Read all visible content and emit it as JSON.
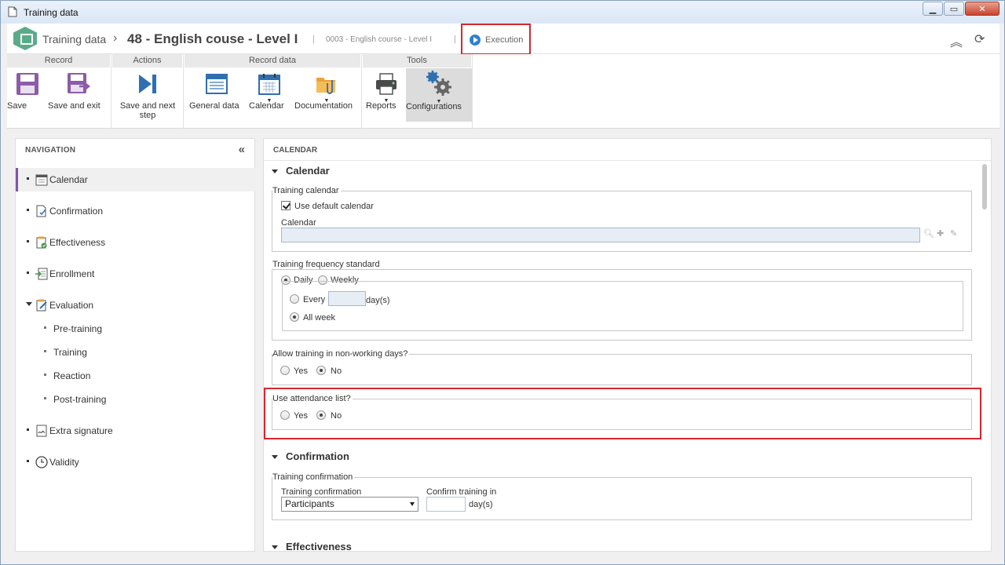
{
  "window": {
    "title": "Training data",
    "controls": [
      "minimize",
      "maximize",
      "close"
    ]
  },
  "header": {
    "app_name": "Training data",
    "separator": "›",
    "record_title": "48 - English couse - Level I",
    "pipe": "|",
    "record_code": "0003 - English course - Level I",
    "status": "Execution"
  },
  "ribbon": {
    "groups": [
      {
        "title": "Record",
        "buttons": [
          {
            "label": "Save"
          },
          {
            "label": "Save and exit"
          }
        ]
      },
      {
        "title": "Actions",
        "buttons": [
          {
            "label": "Save and next step"
          }
        ]
      },
      {
        "title": "Record data",
        "buttons": [
          {
            "label": "General data"
          },
          {
            "label": "Calendar"
          },
          {
            "label": "Documentation"
          }
        ]
      },
      {
        "title": "Tools",
        "buttons": [
          {
            "label": "Reports"
          },
          {
            "label": "Configurations"
          }
        ]
      }
    ]
  },
  "nav": {
    "title": "NAVIGATION",
    "items": [
      {
        "label": "Calendar"
      },
      {
        "label": "Confirmation"
      },
      {
        "label": "Effectiveness"
      },
      {
        "label": "Enrollment"
      },
      {
        "label": "Evaluation"
      },
      {
        "label": "Extra signature"
      },
      {
        "label": "Validity"
      }
    ],
    "evaluation_sub": [
      {
        "label": "Pre-training"
      },
      {
        "label": "Training"
      },
      {
        "label": "Reaction"
      },
      {
        "label": "Post-training"
      }
    ]
  },
  "content": {
    "title": "CALENDAR",
    "calendar_section": {
      "heading": "Calendar",
      "training_calendar": {
        "legend": "Training calendar",
        "use_default_label": "Use default calendar",
        "use_default_checked": true,
        "calendar_label": "Calendar",
        "calendar_value": ""
      },
      "frequency": {
        "legend": "Training frequency standard",
        "daily": "Daily",
        "weekly": "Weekly",
        "selected": "Daily",
        "every": "Every",
        "every_value": "",
        "days_unit": "day(s)",
        "all_week": "All week",
        "mode": "All week"
      },
      "non_working": {
        "legend": "Allow training in non-working days?",
        "yes": "Yes",
        "no": "No",
        "selected": "No"
      },
      "attendance": {
        "legend": "Use attendance list?",
        "yes": "Yes",
        "no": "No",
        "selected": "No"
      }
    },
    "confirmation_section": {
      "heading": "Confirmation",
      "legend": "Training confirmation",
      "confirmation_label": "Training confirmation",
      "confirmation_value": "Participants",
      "confirm_in_label": "Confirm training in",
      "confirm_in_value": "",
      "days_unit": "day(s)"
    },
    "effectiveness_section": {
      "heading": "Effectiveness"
    }
  },
  "colors": {
    "accent": "#7f57a8",
    "highlight": "#d9262e",
    "status": "#2e7fd1",
    "logo": "#5aab8a"
  }
}
